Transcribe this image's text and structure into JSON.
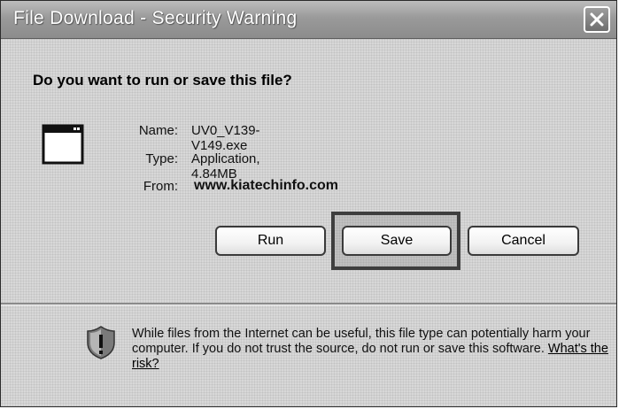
{
  "window": {
    "title": "File Download - Security Warning"
  },
  "dialog": {
    "question": "Do you want to run or save this file?",
    "file": {
      "name_label": "Name:",
      "name_value": "UV0_V139-V149.exe",
      "type_label": "Type:",
      "type_value": "Application, 4.84MB",
      "from_label": "From:",
      "from_value": "www.kiatechinfo.com"
    },
    "buttons": {
      "run": "Run",
      "save": "Save",
      "cancel": "Cancel"
    },
    "warning": {
      "text": "While files from the Internet can be useful, this file type can potentially harm your computer. If you do not trust the source, do not run or save this software.",
      "link": "What's the risk?"
    }
  },
  "icons": {
    "close": "close-icon",
    "file": "application-window-icon",
    "shield": "shield-warning-icon"
  },
  "colors": {
    "dialog_background": "#d8d8d8",
    "titlebar": "#9a9a9a",
    "text": "#000000"
  }
}
